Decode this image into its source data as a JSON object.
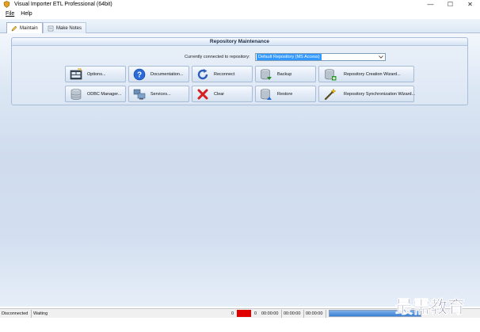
{
  "window": {
    "title": "Visual Importer ETL Professional (64bit)",
    "controls": {
      "minimize": "—",
      "maximize": "☐",
      "close": "✕"
    }
  },
  "menu": {
    "items": [
      "File",
      "Help"
    ]
  },
  "tabs": [
    {
      "label": "Maintain",
      "icon": "pencil-icon",
      "active": true
    },
    {
      "label": "Make Notes",
      "icon": "notes-icon",
      "active": false
    }
  ],
  "panel": {
    "title": "Repository Maintenance",
    "repo_label": "Currently connected to repository:",
    "repo_value": "Default Repository  (MS Access)"
  },
  "buttons": {
    "options": "Options...",
    "documentation": "Documentation...",
    "reconnect": "Reconnect",
    "backup": "Backup",
    "repo_creation": "Repository Creation Wizard...",
    "odbc_manager": "ODBC Manager...",
    "services": "Services...",
    "clear": "Clear",
    "restore": "Restore",
    "repo_sync": "Repository Synchronization Wizard..."
  },
  "status": {
    "connection": "Disconnected",
    "state": "Waiting",
    "count_a": "0",
    "count_b": "0",
    "time_1": "00:00:00",
    "time_2": "00:00:00",
    "time_3": "00:00:00"
  },
  "watermark": "最需教育",
  "colors": {
    "accent": "#3399ff",
    "error_indicator": "#e00000",
    "panel_border": "#a9bdd8"
  }
}
